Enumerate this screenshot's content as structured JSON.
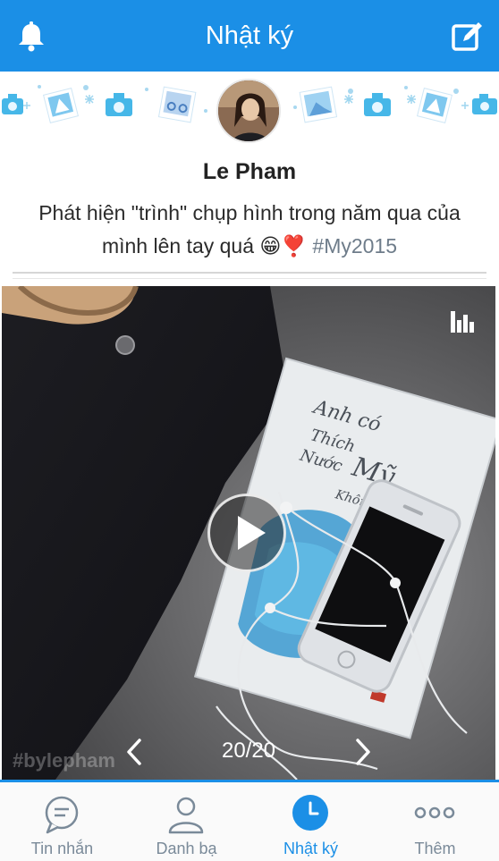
{
  "header": {
    "title": "Nhật ký",
    "left_icon": "bell-icon",
    "right_icon": "compose-icon"
  },
  "post": {
    "author": "Le Pham",
    "caption_text": "Phát hiện \"trình\" chụp hình trong năm qua của mình lên tay quá 😁❣️ ",
    "hashtag": "#My2015",
    "photo": {
      "counter": "20/20",
      "watermark": "#bylepham"
    }
  },
  "tabs": [
    {
      "label": "Tin nhắn",
      "icon": "chat-bubble-icon",
      "active": false
    },
    {
      "label": "Danh bạ",
      "icon": "contact-person-icon",
      "active": false
    },
    {
      "label": "Nhật ký",
      "icon": "clock-icon",
      "active": true
    },
    {
      "label": "Thêm",
      "icon": "more-dots-icon",
      "active": false
    }
  ],
  "colors": {
    "brand": "#1b8fe6",
    "tab_inactive": "#7a8a99",
    "hashtag": "#6e7c8a"
  }
}
